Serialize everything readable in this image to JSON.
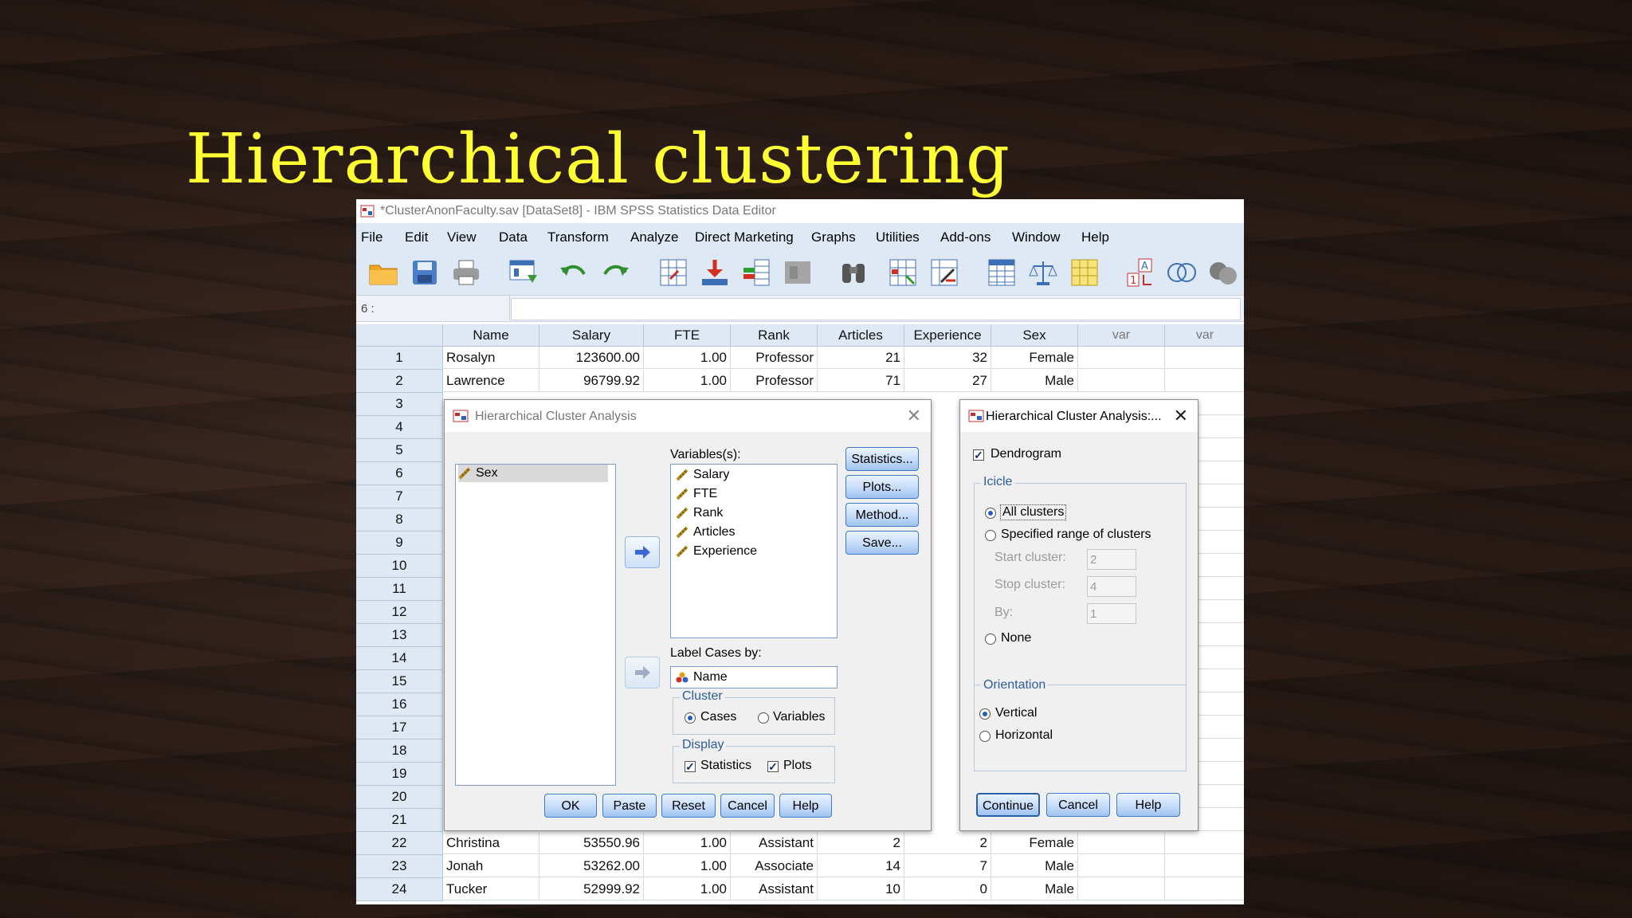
{
  "slide": {
    "title": "Hierarchical clustering"
  },
  "window": {
    "title": "*ClusterAnonFaculty.sav [DataSet8] - IBM SPSS Statistics Data Editor"
  },
  "menu": [
    "File",
    "Edit",
    "View",
    "Data",
    "Transform",
    "Analyze",
    "Direct Marketing",
    "Graphs",
    "Utilities",
    "Add-ons",
    "Window",
    "Help"
  ],
  "toolbar_icons": [
    "open-folder-icon",
    "save-icon",
    "print-icon",
    "dialog-recall-icon",
    "undo-icon",
    "redo-icon",
    "goto-case-icon",
    "goto-variable-icon",
    "variables-icon",
    "run-script-icon",
    "find-icon",
    "insert-cases-icon",
    "insert-variable-icon",
    "split-file-icon",
    "weight-cases-icon",
    "select-cases-icon",
    "value-labels-icon",
    "use-sets-icon",
    "show-all-icon"
  ],
  "cell_ref": "6 :",
  "grid": {
    "headers": [
      "Name",
      "Salary",
      "FTE",
      "Rank",
      "Articles",
      "Experience",
      "Sex",
      "var",
      "var"
    ],
    "row_numbers": [
      "1",
      "2",
      "3",
      "4",
      "5",
      "6",
      "7",
      "8",
      "9",
      "10",
      "11",
      "12",
      "13",
      "14",
      "15",
      "16",
      "17",
      "18",
      "19",
      "20",
      "21",
      "22",
      "23",
      "24"
    ],
    "rows": [
      {
        "n": "1",
        "cells": [
          "Rosalyn",
          "123600.00",
          "1.00",
          "Professor",
          "21",
          "32",
          "Female"
        ]
      },
      {
        "n": "2",
        "cells": [
          "Lawrence",
          "96799.92",
          "1.00",
          "Professor",
          "71",
          "27",
          "Male"
        ]
      },
      {
        "n": "22",
        "cells": [
          "Christina",
          "53550.96",
          "1.00",
          "Assistant",
          "2",
          "2",
          "Female"
        ]
      },
      {
        "n": "23",
        "cells": [
          "Jonah",
          "53262.00",
          "1.00",
          "Associate",
          "14",
          "7",
          "Male"
        ]
      },
      {
        "n": "24",
        "cells": [
          "Tucker",
          "52999.92",
          "1.00",
          "Assistant",
          "10",
          "0",
          "Male"
        ]
      }
    ]
  },
  "main_dialog": {
    "title": "Hierarchical Cluster Analysis",
    "source_list": [
      "Sex"
    ],
    "variables_label": "Variables(s):",
    "variables": [
      "Salary",
      "FTE",
      "Rank",
      "Articles",
      "Experience"
    ],
    "label_cases_label": "Label Cases by:",
    "label_cases_value": "Name",
    "cluster_group": "Cluster",
    "cluster_options": [
      "Cases",
      "Variables"
    ],
    "display_group": "Display",
    "display_options": [
      "Statistics",
      "Plots"
    ],
    "side_buttons": [
      "Statistics...",
      "Plots...",
      "Method...",
      "Save..."
    ],
    "bottom_buttons": [
      "OK",
      "Paste",
      "Reset",
      "Cancel",
      "Help"
    ]
  },
  "plots_dialog": {
    "title": "Hierarchical Cluster Analysis:...",
    "dendrogram": "Dendrogram",
    "icicle_group": "Icicle",
    "icicle_all": "All clusters",
    "icicle_range": "Specified range of clusters",
    "start_label": "Start cluster:",
    "start_value": "2",
    "stop_label": "Stop cluster:",
    "stop_value": "4",
    "by_label": "By:",
    "by_value": "1",
    "icicle_none": "None",
    "orientation_group": "Orientation",
    "orientation_vertical": "Vertical",
    "orientation_horizontal": "Horizontal",
    "buttons": [
      "Continue",
      "Cancel",
      "Help"
    ]
  }
}
